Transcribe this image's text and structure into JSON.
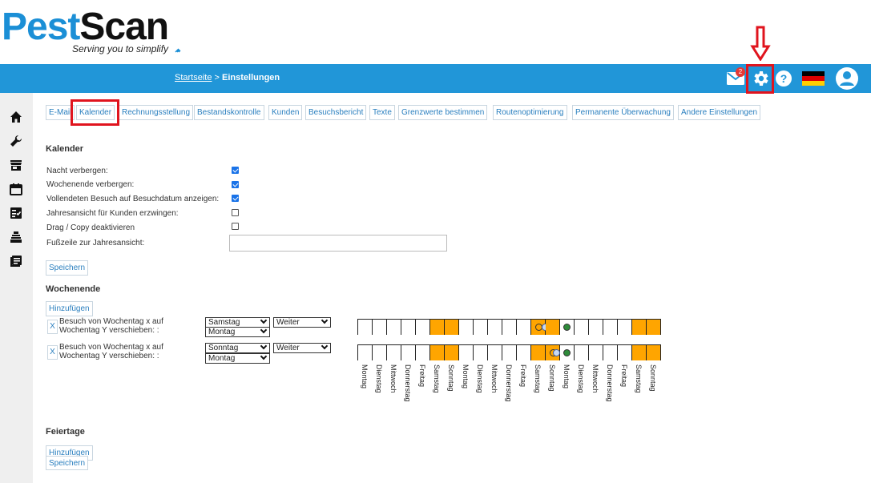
{
  "app": {
    "logo_part1": "Pest",
    "logo_part2": "Scan",
    "tagline": "Serving you to simplify"
  },
  "topbar": {
    "breadcrumb_link": "Startseite",
    "breadcrumb_sep": " > ",
    "breadcrumb_current": "Einstellungen",
    "mail_badge": "2",
    "colors": {
      "bar": "#2196d8",
      "badge": "#e53935",
      "highlight": "#e0141e"
    }
  },
  "tabs": [
    {
      "label": "E-Mail"
    },
    {
      "label": "Kalender"
    },
    {
      "label": "Rechnungsstellung"
    },
    {
      "label": "Bestandskontrolle"
    },
    {
      "label": "Kunden"
    },
    {
      "label": "Besuchsbericht"
    },
    {
      "label": "Texte"
    },
    {
      "label": "Grenzwerte bestimmen"
    },
    {
      "label": "Routenoptimierung"
    },
    {
      "label": "Permanente Überwachung"
    },
    {
      "label": "Andere Einstellungen"
    }
  ],
  "kalender": {
    "title": "Kalender",
    "options": [
      {
        "label": "Nacht verbergen:",
        "checked": true
      },
      {
        "label": "Wochenende verbergen:",
        "checked": true
      },
      {
        "label": "Vollendeten Besuch auf Besuchdatum anzeigen:",
        "checked": true
      },
      {
        "label": "Jahresansicht für Kunden erzwingen:",
        "checked": false
      },
      {
        "label": "Drag / Copy deaktivieren",
        "checked": false
      }
    ],
    "footer_label": "Fußzeile zur Jahresansicht:",
    "footer_value": "",
    "save_label": "Speichern"
  },
  "wochenende": {
    "title": "Wochenende",
    "add_label": "Hinzufügen",
    "rules": [
      {
        "remove": "X",
        "text": "Besuch von Wochentag x auf Wochentag Y verschieben: :",
        "from_day": "Samstag",
        "direction": "Weiter",
        "to_day": "Montag"
      },
      {
        "remove": "X",
        "text": "Besuch von Wochentag x auf Wochentag Y verschieben: :",
        "from_day": "Sonntag",
        "direction": "Weiter",
        "to_day": "Montag"
      }
    ],
    "day_labels": [
      "Montag",
      "Dienstag",
      "Mittwoch",
      "Donnerstag",
      "Freitag",
      "Samstag",
      "Sonntag",
      "Montag",
      "Dienstag",
      "Mittwoch",
      "Donnerstag",
      "Freitag",
      "Samstag",
      "Sonntag",
      "Montag",
      "Dienstag",
      "Mittwoch",
      "Donnerstag",
      "Freitag",
      "Samstag",
      "Sonntag"
    ],
    "colors": {
      "weekend": "#ffa500",
      "moved_from": "#c9d9f2",
      "moved_to": "#2e8b3a"
    }
  },
  "feiertage": {
    "title": "Feiertage",
    "add_label": "Hinzufügen",
    "save_label": "Speichern"
  }
}
